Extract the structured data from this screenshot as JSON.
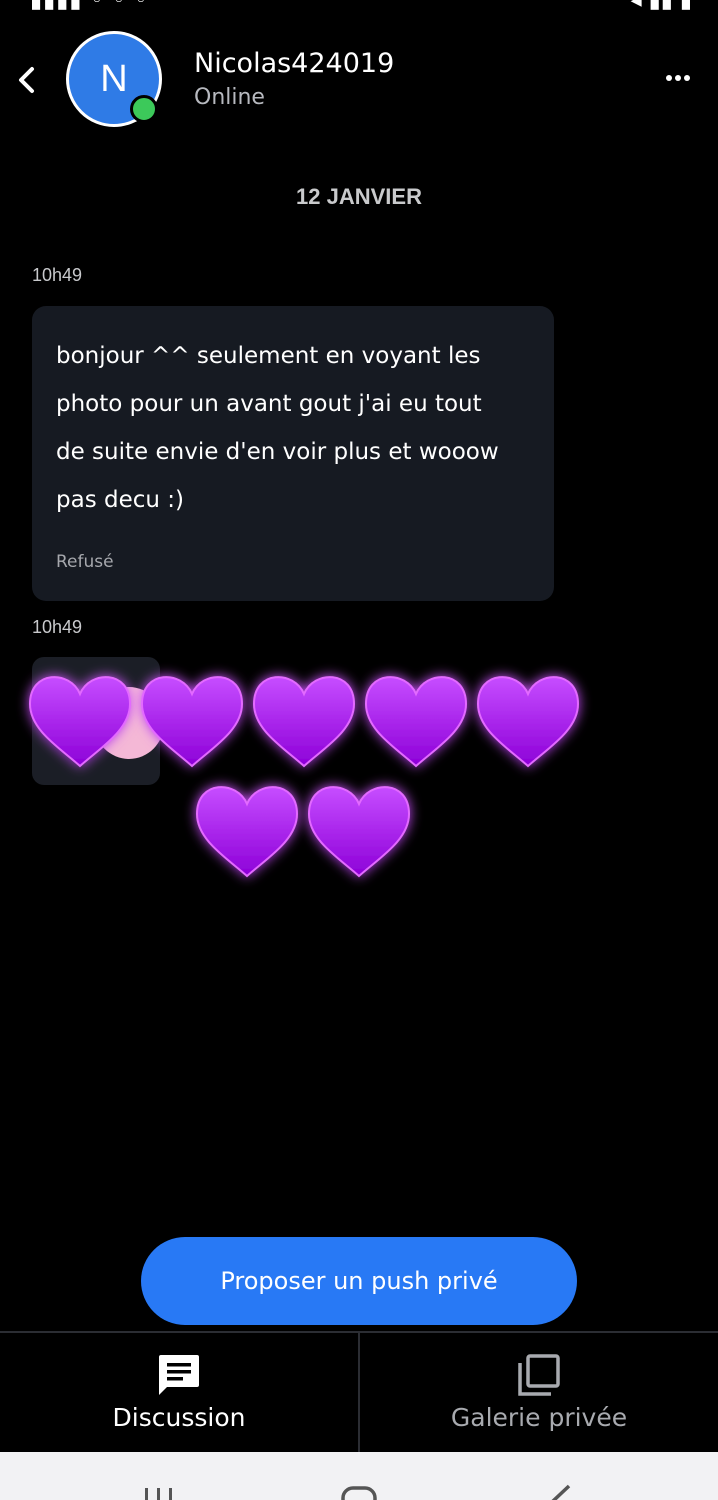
{
  "contact": {
    "initial": "N",
    "name": "Nicolas424019",
    "status": "Online"
  },
  "date_separator": "12 JANVIER",
  "messages": [
    {
      "time": "10h49",
      "lines": [
        "bonjour ^^ seulement en voyant les",
        "photo pour un avant gout j'ai eu tout",
        "de suite envie d'en voir plus et wooow",
        "pas decu :)"
      ],
      "status": "Refusé"
    },
    {
      "time": "10h49",
      "type": "media"
    }
  ],
  "hearts": {
    "count": 7,
    "color": "#b71ff0"
  },
  "push_button": "Proposer un push privé",
  "tabs": [
    {
      "label": "Discussion",
      "icon": "chat-icon",
      "active": true
    },
    {
      "label": "Galerie privée",
      "icon": "gallery-icon",
      "active": false
    }
  ],
  "colors": {
    "accent": "#2879f5",
    "online": "#3cc95a",
    "avatar": "#2f7be6",
    "bubble": "#161a22"
  }
}
